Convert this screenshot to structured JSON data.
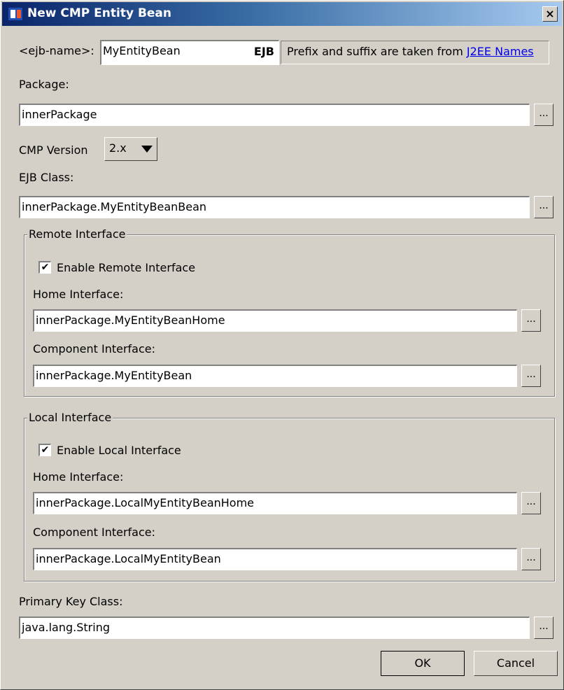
{
  "window": {
    "title": "New CMP Entity Bean",
    "close_label": "×"
  },
  "ejb_name": {
    "label": "<ejb-name>:",
    "value": "MyEntityBean",
    "suffix_badge": "EJB",
    "info_text": "Prefix and suffix are taken from ",
    "info_link": "J2EE Names"
  },
  "package": {
    "label": "Package:",
    "value": "innerPackage"
  },
  "cmp_version": {
    "label": "CMP Version",
    "selected": "2.x"
  },
  "ejb_class": {
    "label": "EJB Class:",
    "value": "innerPackage.MyEntityBeanBean"
  },
  "remote": {
    "legend": "Remote Interface",
    "enable_label": "Enable Remote Interface",
    "enabled": true,
    "home_label": "Home Interface:",
    "home_value": "innerPackage.MyEntityBeanHome",
    "component_label": "Component Interface:",
    "component_value": "innerPackage.MyEntityBean"
  },
  "local": {
    "legend": "Local Interface",
    "enable_label": "Enable Local Interface",
    "enabled": true,
    "home_label": "Home Interface:",
    "home_value": "innerPackage.LocalMyEntityBeanHome",
    "component_label": "Component Interface:",
    "component_value": "innerPackage.LocalMyEntityBean"
  },
  "primary_key": {
    "label": "Primary Key Class:",
    "value": "java.lang.String"
  },
  "browse_label": "...",
  "checkmark": "✔",
  "dialog_buttons": {
    "ok": "OK",
    "cancel": "Cancel"
  }
}
